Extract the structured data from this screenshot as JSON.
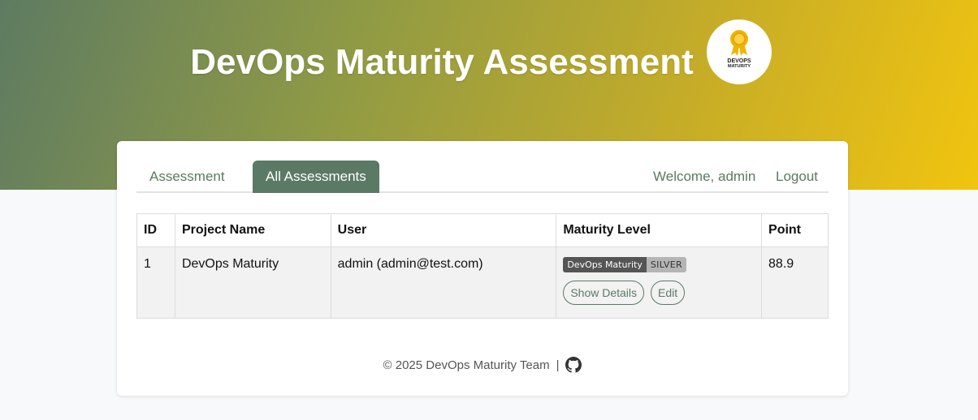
{
  "header": {
    "title": "DevOps Maturity Assessment",
    "logo_line1": "DEVOPS",
    "logo_line2": "MATURITY",
    "gradient_start": "#5e7b62",
    "gradient_end": "#f1c40f"
  },
  "nav": {
    "tabs": [
      {
        "label": "Assessment",
        "active": false
      },
      {
        "label": "All Assessments",
        "active": true
      }
    ],
    "welcome": "Welcome, admin",
    "logout": "Logout"
  },
  "table": {
    "columns": [
      "ID",
      "Project Name",
      "User",
      "Maturity Level",
      "Point"
    ],
    "rows": [
      {
        "id": "1",
        "project": "DevOps Maturity",
        "user": "admin (admin@test.com)",
        "badge_left": "DevOps Maturity",
        "badge_right": "SILVER",
        "point": "88.9",
        "actions": [
          "Show Details",
          "Edit"
        ]
      }
    ]
  },
  "footer": {
    "text": "© 2025 DevOps Maturity Team",
    "separator": "|",
    "icon": "github-icon"
  },
  "colors": {
    "accent": "#5a7a65",
    "badge_dark": "#555555",
    "badge_silver": "#b5b5b5"
  }
}
